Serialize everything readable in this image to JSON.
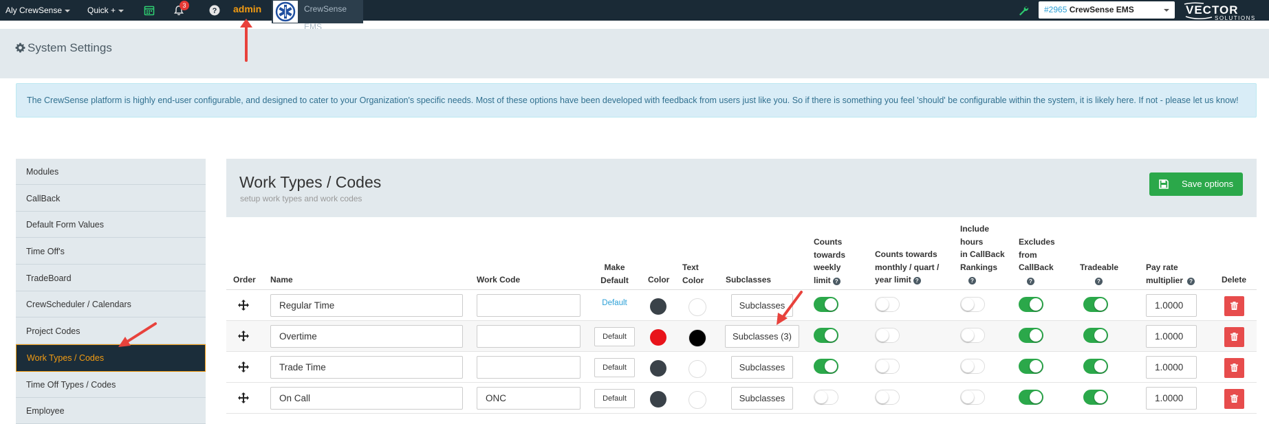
{
  "topnav": {
    "user_menu": "Aly CrewSense",
    "quick_menu": "Quick +",
    "notification_count": "3",
    "admin_link": "admin",
    "org_name": "CrewSense EMS",
    "account_number": "#2965",
    "account_name": "CrewSense EMS",
    "brand_top": "VECTOR",
    "brand_bottom": "SOLUTIONS"
  },
  "page": {
    "title": "System Settings",
    "info_text": "The CrewSense platform is highly end-user configurable, and designed to cater to your Organization's specific needs. Most of these options have been developed with feedback from users just like you. So if there is something you feel 'should' be configurable within the system, it is likely here. If not - please let us know!"
  },
  "sidebar": {
    "items": [
      {
        "label": "Modules"
      },
      {
        "label": "CallBack"
      },
      {
        "label": "Default Form Values"
      },
      {
        "label": "Time Off's"
      },
      {
        "label": "TradeBoard"
      },
      {
        "label": "CrewScheduler / Calendars"
      },
      {
        "label": "Project Codes"
      },
      {
        "label": "Work Types / Codes",
        "active": true
      },
      {
        "label": "Time Off Types / Codes"
      },
      {
        "label": "Employee"
      }
    ]
  },
  "panel": {
    "title": "Work Types / Codes",
    "subtitle": "setup work types and work codes",
    "save_label": "Save options"
  },
  "table": {
    "headers": {
      "order": "Order",
      "name": "Name",
      "work_code": "Work Code",
      "make_default_1": "Make",
      "make_default_2": "Default",
      "color": "Color",
      "text_color_1": "Text",
      "text_color_2": "Color",
      "subclasses": "Subclasses",
      "weekly_1": "Counts",
      "weekly_2": "towards",
      "weekly_3": "weekly",
      "weekly_4": "limit",
      "monthly_1": "Counts towards",
      "monthly_2": "monthly / quart /",
      "monthly_3": "year limit",
      "include_1": "Include",
      "include_2": "hours",
      "include_3": "in CallBack",
      "include_4": "Rankings",
      "excludes_1": "Excludes",
      "excludes_2": "from",
      "excludes_3": "CallBack",
      "tradeable": "Tradeable",
      "pay_1": "Pay rate",
      "pay_2": "multiplier",
      "delete": "Delete"
    },
    "default_link_label": "Default",
    "default_button_label": "Default",
    "rows": [
      {
        "name": "Regular Time",
        "work_code": "",
        "is_default": true,
        "color": "#3a4249",
        "text_color": "#ffffff",
        "subclasses": "Subclasses",
        "weekly": true,
        "monthly": false,
        "include_callback": false,
        "excludes_callback": true,
        "tradeable": true,
        "pay_rate": "1.0000"
      },
      {
        "name": "Overtime",
        "work_code": "",
        "is_default": false,
        "color": "#e8141b",
        "text_color": "#000000",
        "subclasses": "Subclasses (3)",
        "weekly": true,
        "monthly": false,
        "include_callback": false,
        "excludes_callback": true,
        "tradeable": true,
        "pay_rate": "1.0000"
      },
      {
        "name": "Trade Time",
        "work_code": "",
        "is_default": false,
        "color": "#3a4249",
        "text_color": "#ffffff",
        "subclasses": "Subclasses",
        "weekly": true,
        "monthly": false,
        "include_callback": false,
        "excludes_callback": true,
        "tradeable": true,
        "pay_rate": "1.0000"
      },
      {
        "name": "On Call",
        "work_code": "ONC",
        "is_default": false,
        "color": "#3a4249",
        "text_color": "#ffffff",
        "subclasses": "Subclasses",
        "weekly": false,
        "monthly": false,
        "include_callback": false,
        "excludes_callback": true,
        "tradeable": true,
        "pay_rate": "1.0000"
      }
    ]
  },
  "colors": {
    "nav_bg": "#1a2a36",
    "accent_orange": "#f39c12",
    "toggle_on": "#2ba84a",
    "delete_red": "#e74c4c",
    "info_bg": "#d9edf7"
  }
}
